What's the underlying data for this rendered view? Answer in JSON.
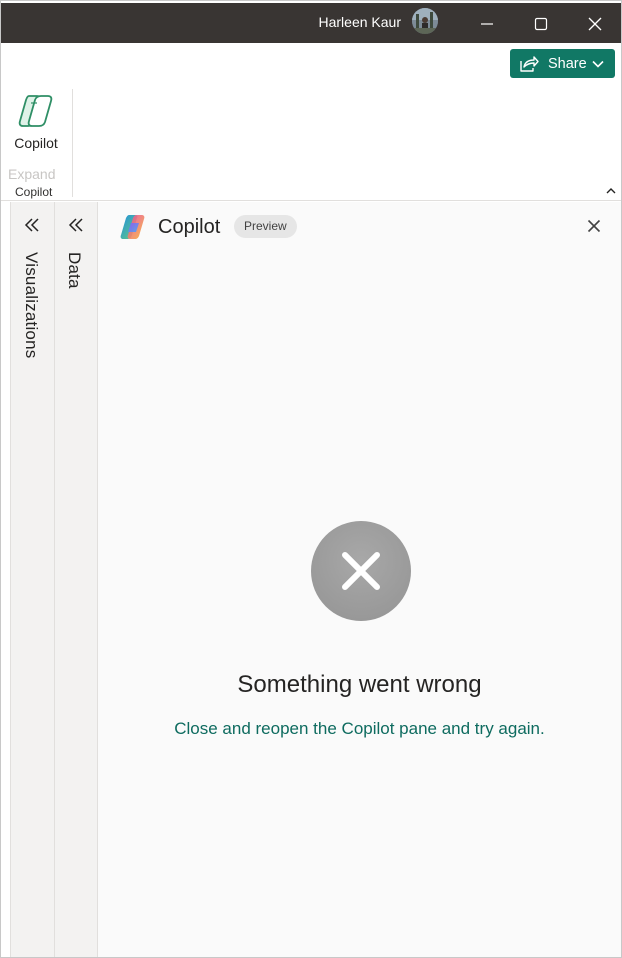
{
  "titlebar": {
    "user_name": "Harleen Kaur",
    "icons": {
      "avatar": "user-avatar",
      "minimize": "minimize-icon",
      "maximize": "maximize-icon",
      "close": "close-icon"
    }
  },
  "ribbon": {
    "share_label": "Share",
    "share_icon": "share-icon",
    "copilot_button_label": "Copilot",
    "expand_label": "Expand",
    "group_label": "Copilot"
  },
  "side_panes": {
    "visualizations_label": "Visualizations",
    "data_label": "Data"
  },
  "copilot_pane": {
    "title": "Copilot",
    "badge": "Preview",
    "error_title": "Something went wrong",
    "error_message": "Close and reopen the Copilot pane and try again."
  },
  "colors": {
    "titlebar_bg": "#393533",
    "accent": "#117865",
    "error_link_text": "#0e6b5f",
    "pane_bg": "#fafafa",
    "error_circle": "#9e9e9e"
  }
}
